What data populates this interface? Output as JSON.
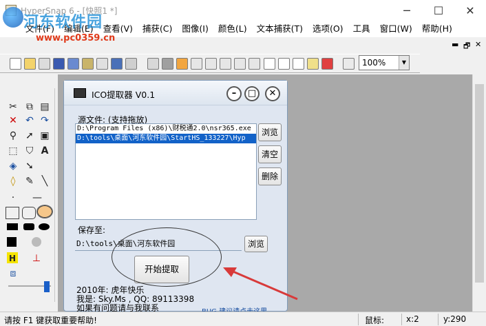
{
  "window": {
    "title": "HyperSnap 6 - [快照1 *]",
    "minimize_glyph": "─",
    "maximize_glyph": "☐",
    "close_glyph": "✕",
    "mdi_minimize_glyph": "▬",
    "mdi_restore_glyph": "🗗",
    "mdi_close_glyph": "✕"
  },
  "watermark": {
    "title": "河东软件园",
    "url": "www.pc0359.cn"
  },
  "menu": [
    "文件(F)",
    "编辑(E)",
    "查看(V)",
    "捕获(C)",
    "图像(I)",
    "颜色(L)",
    "文本捕获(T)",
    "选项(O)",
    "工具",
    "窗口(W)",
    "帮助(H)"
  ],
  "toolbar": {
    "zoom_value": "100%"
  },
  "dialog": {
    "title": "ICO提取器 V0.1",
    "source_label": "源文件:  (支持拖放)",
    "files": [
      "D:\\Program Files (x86)\\财税通2.0\\nsr365.exe",
      "D:\\tools\\桌面\\河东软件园\\StartHS_133227\\Hyp"
    ],
    "browse_label": "浏览",
    "clear_label": "清空",
    "delete_label": "删除",
    "save_label": "保存至:",
    "save_path": "D:\\tools\\桌面\\河东软件园",
    "save_browse_label": "浏览",
    "start_label": "开始提取",
    "info_lines": [
      "2010年: 虎年快乐",
      "我是: Sky.Ms , QQ: 89113398",
      "如果有问题请与我联系"
    ],
    "overflow_text": "BUG 建议请点击这里"
  },
  "status": {
    "help_text": "请按 F1 键获取重要帮助!",
    "mouse_label": "鼠标:",
    "x_label": "x:2",
    "y_label": "y:290"
  },
  "colors": {
    "accent": "#1262c8",
    "workspace": "#a9a9a9",
    "arrow": "#d83a3a"
  }
}
